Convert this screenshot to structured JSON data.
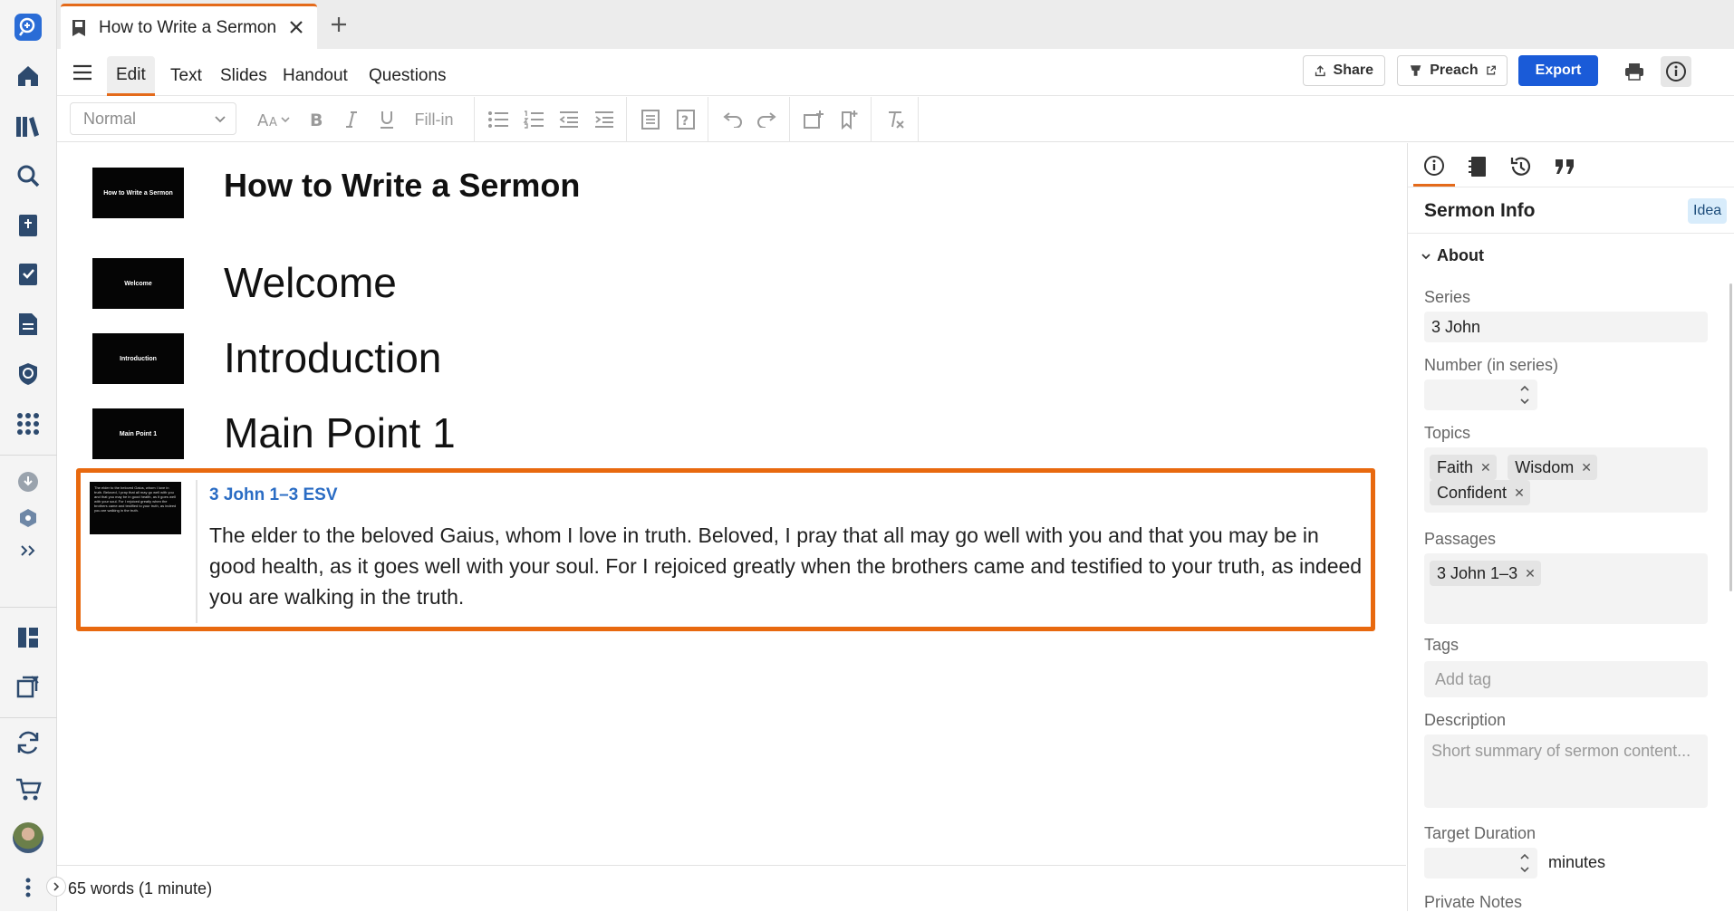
{
  "rail": {
    "items": [
      {
        "icon": "logos-search-icon"
      },
      {
        "icon": "home-icon"
      },
      {
        "icon": "library-icon"
      },
      {
        "icon": "search-icon"
      },
      {
        "icon": "bible-icon"
      },
      {
        "icon": "checklist-icon"
      },
      {
        "icon": "document-icon"
      },
      {
        "icon": "shield-icon"
      },
      {
        "icon": "apps-grid-icon"
      },
      {
        "icon": "download-icon"
      },
      {
        "icon": "package-icon"
      },
      {
        "icon": "more-chevrons-icon"
      },
      {
        "icon": "layout-icon"
      },
      {
        "icon": "close-panels-icon"
      },
      {
        "icon": "sync-icon"
      },
      {
        "icon": "cart-icon"
      },
      {
        "icon": "user-avatar"
      },
      {
        "icon": "kebab-menu-icon"
      }
    ]
  },
  "tab": {
    "title": "How to Write a Sermon"
  },
  "menu": {
    "items": [
      "Edit",
      "Text",
      "Slides",
      "Handout",
      "Questions"
    ],
    "active": "Edit",
    "share_label": "Share",
    "preach_label": "Preach",
    "export_label": "Export",
    "accent": "#e46a1a",
    "export_color": "#1a5bd8"
  },
  "toolbar": {
    "style_value": "Normal",
    "fillin_label": "Fill-in"
  },
  "editor": {
    "doc_title": "How to Write a Sermon",
    "thumbs": {
      "title": "How to Write a Sermon",
      "welcome": "Welcome",
      "introduction": "Introduction",
      "main_point_1": "Main Point 1"
    },
    "headings": [
      "Welcome",
      "Introduction",
      "Main Point 1"
    ],
    "passage": {
      "reference": "3 John 1–3 ESV",
      "text": "The elder to the beloved Gaius, whom I love in truth. Beloved, I pray that all may go well with you and that you may be in good health, as it goes well with your soul. For I rejoiced greatly when the brothers came and testified to your truth, as indeed you are walking in the truth.",
      "highlight_color": "#e8690f"
    }
  },
  "status": {
    "word_count": "65 words (1 minute)"
  },
  "panel": {
    "title": "Sermon Info",
    "badge": "Idea",
    "section": "About",
    "series_label": "Series",
    "series_value": "3 John",
    "number_label": "Number (in series)",
    "topics_label": "Topics",
    "topics": [
      "Faith",
      "Wisdom",
      "Confident"
    ],
    "passages_label": "Passages",
    "passages": [
      "3 John 1–3"
    ],
    "tags_label": "Tags",
    "tags_placeholder": "Add tag",
    "description_label": "Description",
    "description_placeholder": "Short summary of sermon content...",
    "duration_label": "Target Duration",
    "duration_unit": "minutes",
    "private_notes_label": "Private Notes"
  }
}
